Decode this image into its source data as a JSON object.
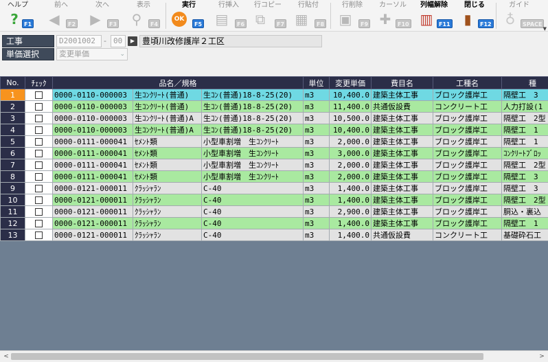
{
  "toolbar": {
    "help": {
      "label": "ヘルプ",
      "key": "F1"
    },
    "prev": {
      "label": "前へ",
      "key": "F2"
    },
    "next": {
      "label": "次へ",
      "key": "F3"
    },
    "view": {
      "label": "表示",
      "key": "F4"
    },
    "execute": {
      "label": "実行",
      "key": "F5"
    },
    "insert_row": {
      "label": "行挿入",
      "key": "F6"
    },
    "copy_row": {
      "label": "行コピー",
      "key": "F7"
    },
    "paste_row": {
      "label": "行貼付",
      "key": "F8"
    },
    "delete_row": {
      "label": "行削除",
      "key": "F9"
    },
    "cursor": {
      "label": "カーソル",
      "key": "F10"
    },
    "release_width": {
      "label": "列幅解除",
      "key": "F11"
    },
    "close": {
      "label": "閉じる",
      "key": "F12"
    },
    "guide": {
      "label": "ガイド",
      "key": "SPACE"
    }
  },
  "form": {
    "project_label": "工事",
    "project_code": "D2001002",
    "dash": "-",
    "project_sub": "00",
    "project_name": "豊頃川改修護岸２工区",
    "price_select_label": "単価選択",
    "price_select_value": "変更単価"
  },
  "grid": {
    "headers": [
      "No.",
      "ﾁｪｯｸ",
      "品名／規格",
      "単位",
      "変更単価",
      "費目名",
      "工種名",
      "種"
    ],
    "rows": [
      {
        "no": "1",
        "code": "0000-0110-000003",
        "name": "生ｺﾝｸﾘｰﾄ(普通)",
        "spec": "生ｺﾝ(普通)18-8-25(20)",
        "unit": "m3",
        "price": "10,400.0",
        "cost": "建築主体工事",
        "work": "ブロック護岸工",
        "type": "隔壁工　3",
        "color": "cyan",
        "selected": true
      },
      {
        "no": "2",
        "code": "0000-0110-000003",
        "name": "生ｺﾝｸﾘｰﾄ(普通)",
        "spec": "生ｺﾝ(普通)18-8-25(20)",
        "unit": "m3",
        "price": "11,400.0",
        "cost": "共通仮設費",
        "work": "コンクリート工",
        "type": "人力打設(1",
        "color": "green"
      },
      {
        "no": "3",
        "code": "0000-0110-000003",
        "name": "生ｺﾝｸﾘｰﾄ(普通)A",
        "spec": "生ｺﾝ(普通)18-8-25(20)",
        "unit": "m3",
        "price": "10,500.0",
        "cost": "建築主体工事",
        "work": "ブロック護岸工",
        "type": "隔壁工　2型",
        "color": "white"
      },
      {
        "no": "4",
        "code": "0000-0110-000003",
        "name": "生ｺﾝｸﾘｰﾄ(普通)A",
        "spec": "生ｺﾝ(普通)18-8-25(20)",
        "unit": "m3",
        "price": "10,400.0",
        "cost": "建築主体工事",
        "work": "ブロック護岸工",
        "type": "隔壁工　1",
        "color": "green"
      },
      {
        "no": "5",
        "code": "0000-0111-000041",
        "name": "ｾﾒﾝﾄ類",
        "spec": "小型車割増　生ｺﾝｸﾘｰﾄ",
        "unit": "m3",
        "price": "2,000.0",
        "cost": "建築主体工事",
        "work": "ブロック護岸工",
        "type": "隔壁工　1",
        "color": "white"
      },
      {
        "no": "6",
        "code": "0000-0111-000041",
        "name": "ｾﾒﾝﾄ類",
        "spec": "小型車割増　生ｺﾝｸﾘｰﾄ",
        "unit": "m3",
        "price": "3,000.0",
        "cost": "建築主体工事",
        "work": "ブロック護岸工",
        "type": "ｺﾝｸﾘｰﾄﾌﾞﾛｯ",
        "color": "green"
      },
      {
        "no": "7",
        "code": "0000-0111-000041",
        "name": "ｾﾒﾝﾄ類",
        "spec": "小型車割増　生ｺﾝｸﾘｰﾄ",
        "unit": "m3",
        "price": "2,000.0",
        "cost": "建築主体工事",
        "work": "ブロック護岸工",
        "type": "隔壁工　2型",
        "color": "white"
      },
      {
        "no": "8",
        "code": "0000-0111-000041",
        "name": "ｾﾒﾝﾄ類",
        "spec": "小型車割増　生ｺﾝｸﾘｰﾄ",
        "unit": "m3",
        "price": "2,000.0",
        "cost": "建築主体工事",
        "work": "ブロック護岸工",
        "type": "隔壁工　3",
        "color": "green"
      },
      {
        "no": "9",
        "code": "0000-0121-000011",
        "name": "ｸﾗｯｼｬﾗﾝ",
        "spec": "C-40",
        "unit": "m3",
        "price": "1,400.0",
        "cost": "建築主体工事",
        "work": "ブロック護岸工",
        "type": "隔壁工　3",
        "color": "white"
      },
      {
        "no": "10",
        "code": "0000-0121-000011",
        "name": "ｸﾗｯｼｬﾗﾝ",
        "spec": "C-40",
        "unit": "m3",
        "price": "1,400.0",
        "cost": "建築主体工事",
        "work": "ブロック護岸工",
        "type": "隔壁工　2型",
        "color": "green"
      },
      {
        "no": "11",
        "code": "0000-0121-000011",
        "name": "ｸﾗｯｼｬﾗﾝ",
        "spec": "C-40",
        "unit": "m3",
        "price": "2,900.0",
        "cost": "建築主体工事",
        "work": "ブロック護岸工",
        "type": "胴込・裏込",
        "color": "white"
      },
      {
        "no": "12",
        "code": "0000-0121-000011",
        "name": "ｸﾗｯｼｬﾗﾝ",
        "spec": "C-40",
        "unit": "m3",
        "price": "1,400.0",
        "cost": "建築主体工事",
        "work": "ブロック護岸工",
        "type": "隔壁工　1",
        "color": "green"
      },
      {
        "no": "13",
        "code": "0000-0121-000011",
        "name": "ｸﾗｯｼｬﾗﾝ",
        "spec": "C-40",
        "unit": "m3",
        "price": "1,400.0",
        "cost": "共通仮設費",
        "work": "コンクリート工",
        "type": "基礎砕石工",
        "color": "white"
      }
    ]
  },
  "scrollbar": {
    "left_arrow": "<",
    "right_arrow": ">"
  }
}
